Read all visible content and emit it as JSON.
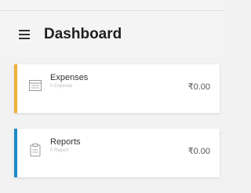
{
  "header": {
    "title": "Dashboard",
    "menu_icon": "hamburger-menu-icon"
  },
  "cards": [
    {
      "title": "Expenses",
      "subtitle": "0 Expense",
      "amount": "₹0.00",
      "accent_color": "#f0b13a",
      "icon": "expenses-list-icon"
    },
    {
      "title": "Reports",
      "subtitle": "0 Report",
      "amount": "₹0.00",
      "accent_color": "#1f8ac7",
      "icon": "reports-clipboard-icon"
    }
  ]
}
